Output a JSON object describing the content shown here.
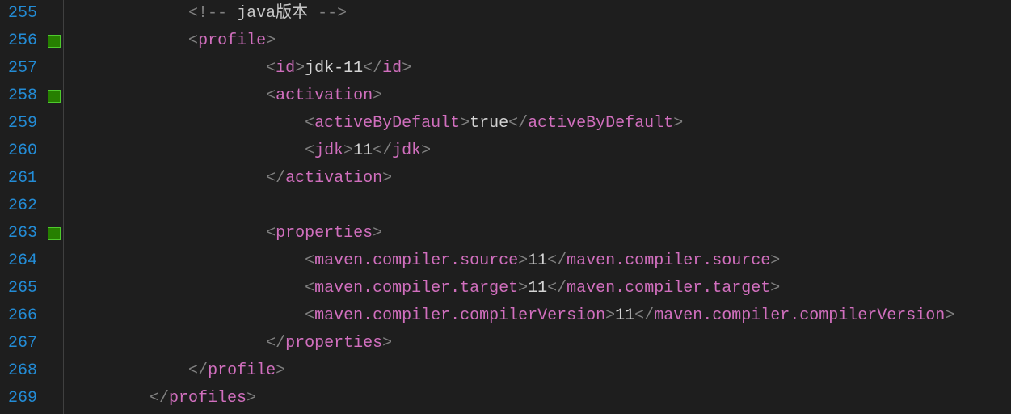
{
  "gutter": {
    "start": 255,
    "end": 269
  },
  "fold_markers_at": [
    256,
    258,
    263
  ],
  "code": {
    "indent_unit": "    ",
    "lines": [
      {
        "n": 255,
        "indent": 3,
        "kind": "comment",
        "text": " java版本 "
      },
      {
        "n": 256,
        "indent": 3,
        "kind": "open",
        "tag": "profile"
      },
      {
        "n": 257,
        "indent": 5,
        "kind": "leaf",
        "tag": "id",
        "value": "jdk-11"
      },
      {
        "n": 258,
        "indent": 5,
        "kind": "open",
        "tag": "activation"
      },
      {
        "n": 259,
        "indent": 6,
        "kind": "leaf",
        "tag": "activeByDefault",
        "value": "true"
      },
      {
        "n": 260,
        "indent": 6,
        "kind": "leaf",
        "tag": "jdk",
        "value": "11"
      },
      {
        "n": 261,
        "indent": 5,
        "kind": "close",
        "tag": "activation"
      },
      {
        "n": 262,
        "indent": 0,
        "kind": "blank"
      },
      {
        "n": 263,
        "indent": 5,
        "kind": "open",
        "tag": "properties"
      },
      {
        "n": 264,
        "indent": 6,
        "kind": "leaf",
        "tag": "maven.compiler.source",
        "value": "11"
      },
      {
        "n": 265,
        "indent": 6,
        "kind": "leaf",
        "tag": "maven.compiler.target",
        "value": "11"
      },
      {
        "n": 266,
        "indent": 6,
        "kind": "leaf",
        "tag": "maven.compiler.compilerVersion",
        "value": "11"
      },
      {
        "n": 267,
        "indent": 5,
        "kind": "close",
        "tag": "properties"
      },
      {
        "n": 268,
        "indent": 3,
        "kind": "close",
        "tag": "profile"
      },
      {
        "n": 269,
        "indent": 2,
        "kind": "close",
        "tag": "profiles"
      }
    ]
  }
}
